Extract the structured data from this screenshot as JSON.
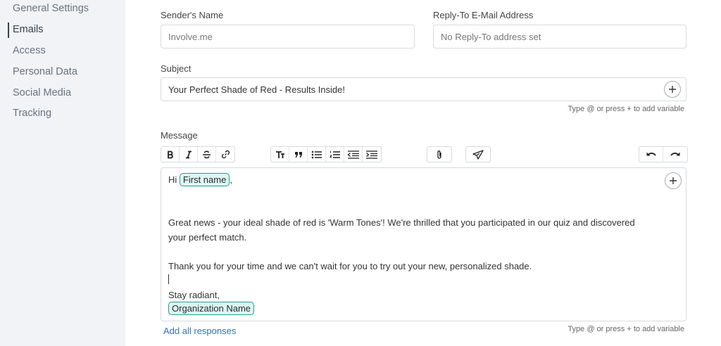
{
  "sidebar": {
    "items": [
      {
        "label": "General Settings"
      },
      {
        "label": "Emails"
      },
      {
        "label": "Access"
      },
      {
        "label": "Personal Data"
      },
      {
        "label": "Social Media"
      },
      {
        "label": "Tracking"
      }
    ],
    "active_index": 1
  },
  "form": {
    "sender_name": {
      "label": "Sender's Name",
      "placeholder": "Involve.me"
    },
    "reply_to": {
      "label": "Reply-To E-Mail Address",
      "placeholder": "No Reply-To address set"
    },
    "subject": {
      "label": "Subject",
      "value": "Your Perfect Shade of Red - Results Inside!"
    },
    "variable_hint": "Type @ or press + to add variable",
    "message": {
      "label": "Message",
      "greeting": "Hi",
      "first_name_tag": "First name",
      "greeting_suffix": ",",
      "line1": "Great news - your ideal shade of red is 'Warm Tones'! We're thrilled that you participated in our quiz and discovered",
      "line2": "your perfect match.",
      "line3": "Thank you for your time and we can't wait for you to try out your new, personalized shade.",
      "signoff": "Stay radiant,",
      "org_tag": "Organization Name"
    },
    "add_all_responses": "Add all responses"
  },
  "toolbar": {
    "icons": [
      "bold-icon",
      "italic-icon",
      "strikethrough-icon",
      "link-icon",
      "text-size-icon",
      "quote-icon",
      "bullet-list-icon",
      "numbered-list-icon",
      "outdent-icon",
      "indent-icon",
      "attachment-icon",
      "send-icon",
      "undo-icon",
      "redo-icon"
    ]
  }
}
